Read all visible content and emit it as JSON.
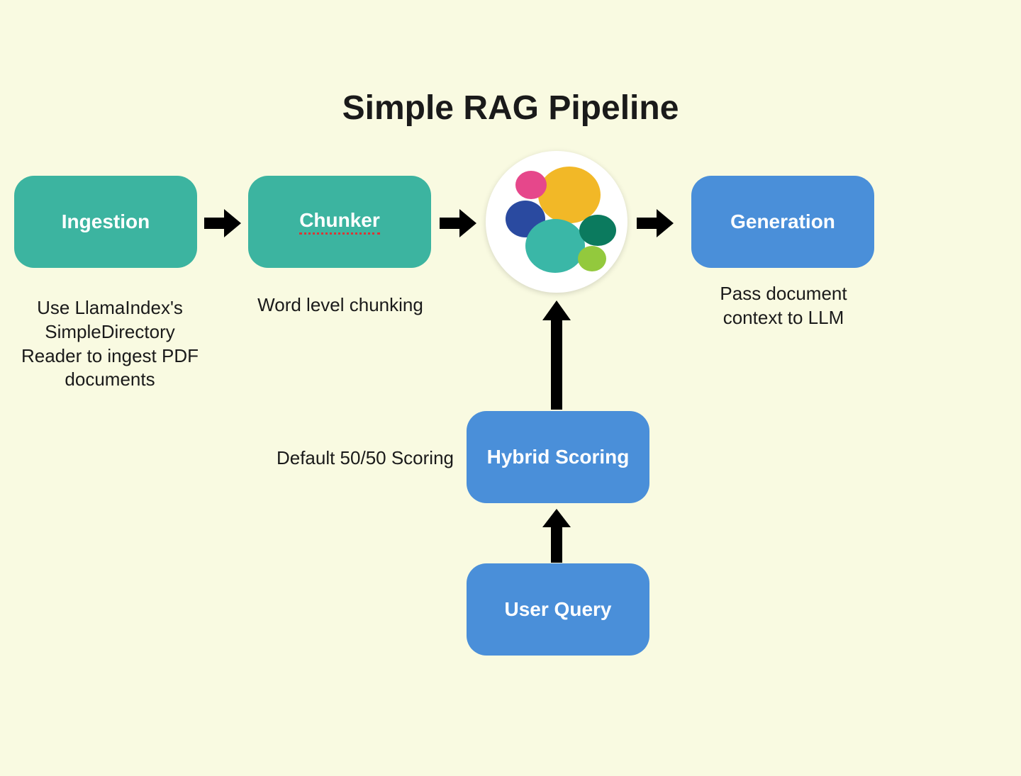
{
  "title": "Simple RAG Pipeline",
  "nodes": {
    "ingestion": {
      "label": "Ingestion",
      "caption": "Use LlamaIndex's SimpleDirectory Reader to ingest PDF documents"
    },
    "chunker": {
      "label": "Chunker",
      "caption": "Word level chunking"
    },
    "elastic": {
      "alt": "Elasticsearch logo"
    },
    "generation": {
      "label": "Generation",
      "caption": "Pass document context to LLM"
    },
    "hybrid": {
      "label": "Hybrid Scoring",
      "caption": "Default 50/50 Scoring"
    },
    "userquery": {
      "label": "User Query"
    }
  },
  "colors": {
    "teal": "#3cb4a0",
    "blue": "#4a8fd9",
    "background": "#f9fae1",
    "arrow": "#000000"
  }
}
